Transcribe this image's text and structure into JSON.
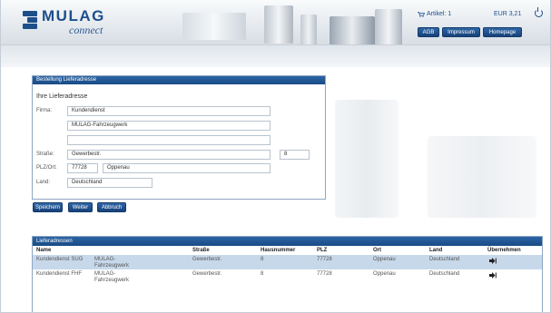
{
  "header": {
    "logo_word": "MULAG",
    "logo_sub": "connect",
    "cart_label": "Artikel: 1",
    "cart_total": "EUR 3,21",
    "buttons": [
      "AGB",
      "Impressum",
      "Homepage"
    ]
  },
  "form": {
    "title": "Bestellung Lieferadresse",
    "subtitle": "Ihre Lieferadresse",
    "labels": {
      "firma": "Firma:",
      "strasse": "Straße:",
      "plz_ort": "PLZ/Ort:",
      "land": "Land:"
    },
    "values": {
      "firma1": "Kundendienst",
      "firma2": "MULAG-Fahrzeugwerk",
      "firma3": "",
      "strasse": "Gewerbestr.",
      "hausnummer": "8",
      "plz": "77728",
      "ort": "Oppenau",
      "land": "Deutschland"
    },
    "buttons": {
      "save": "Speichern",
      "next": "Weiter",
      "cancel": "Abbruch"
    }
  },
  "addresses": {
    "title": "Lieferadressen",
    "columns": [
      "Name",
      "Straße",
      "Hausnummer",
      "PLZ",
      "Ort",
      "Land",
      "Übernehmen"
    ],
    "rows": [
      {
        "name": "Kundendienst SUG",
        "firma_l1": "MULAG-",
        "firma_l2": "Fahrzeugwerk",
        "strasse": "Gewerbestr.",
        "hausnummer": "8",
        "plz": "77728",
        "ort": "Oppenau",
        "land": "Deutschland",
        "selected": true
      },
      {
        "name": "Kundendienst FHF",
        "firma_l1": "MULAG-",
        "firma_l2": "Fahrzeugwerk",
        "strasse": "Gewerbestr.",
        "hausnummer": "8",
        "plz": "77728",
        "ort": "Oppenau",
        "land": "Deutschland",
        "selected": false
      }
    ]
  },
  "colors": {
    "brand": "#1d4f8a",
    "panel_header": "#1f548f",
    "selected_row": "#c7d8ea"
  },
  "icons": {
    "cart": "cart-icon",
    "power": "power-icon",
    "take_over": "arrow-into-box-icon"
  }
}
